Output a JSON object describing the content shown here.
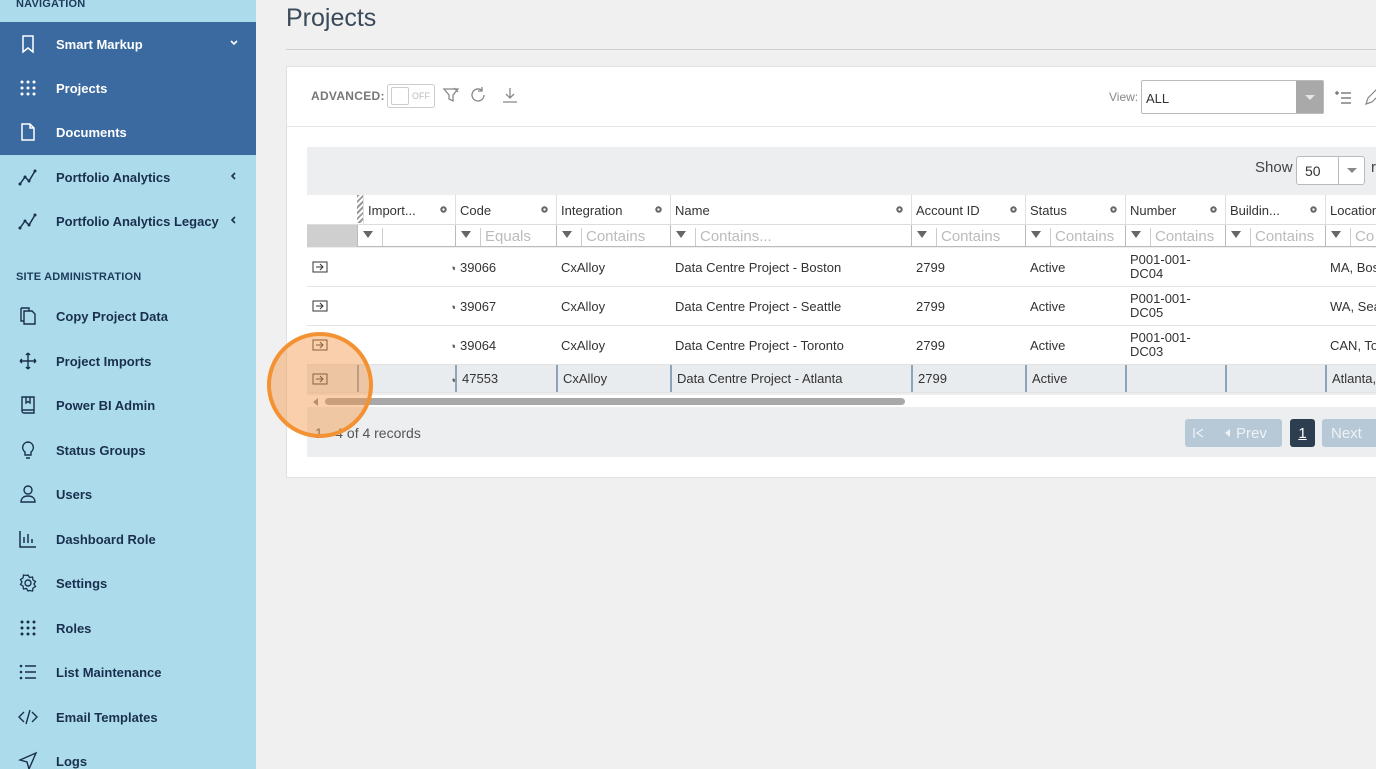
{
  "sidebar": {
    "nav_title": "NAVIGATION",
    "admin_title": "SITE ADMINISTRATION",
    "nav_items": [
      {
        "label": "Smart Markup",
        "icon": "bookmark-icon"
      },
      {
        "label": "Projects",
        "icon": "grid-dots-icon"
      },
      {
        "label": "Documents",
        "icon": "document-icon"
      },
      {
        "label": "Portfolio Analytics",
        "icon": "analytics-icon"
      },
      {
        "label": "Portfolio Analytics Legacy",
        "icon": "analytics-icon"
      }
    ],
    "admin_items": [
      {
        "label": "Copy Project Data",
        "icon": "copy-icon"
      },
      {
        "label": "Project Imports",
        "icon": "move-icon"
      },
      {
        "label": "Power BI Admin",
        "icon": "book-icon"
      },
      {
        "label": "Status Groups",
        "icon": "lightbulb-icon"
      },
      {
        "label": "Users",
        "icon": "user-icon"
      },
      {
        "label": "Dashboard Role",
        "icon": "bar-chart-icon"
      },
      {
        "label": "Settings",
        "icon": "gear-icon"
      },
      {
        "label": "Roles",
        "icon": "grid-dots-icon"
      },
      {
        "label": "List Maintenance",
        "icon": "list-icon"
      },
      {
        "label": "Email Templates",
        "icon": "code-icon"
      },
      {
        "label": "Logs",
        "icon": "send-icon"
      }
    ]
  },
  "page": {
    "title": "Projects"
  },
  "toolbar": {
    "advanced_label": "ADVANCED:",
    "toggle_state": "OFF",
    "view_label": "View:",
    "view_value": "ALL"
  },
  "grid": {
    "show_label": "Show",
    "show_value": "50",
    "show_suffix": "r",
    "columns": [
      {
        "label": "Import...",
        "filter": ""
      },
      {
        "label": "Code",
        "filter": "Equals"
      },
      {
        "label": "Integration",
        "filter": "Contains"
      },
      {
        "label": "Name",
        "filter": "Contains..."
      },
      {
        "label": "Account ID",
        "filter": "Contains"
      },
      {
        "label": "Status",
        "filter": "Contains"
      },
      {
        "label": "Number",
        "filter": "Contains"
      },
      {
        "label": "Buildin...",
        "filter": "Contains"
      },
      {
        "label": "Location",
        "filter": "Co"
      }
    ],
    "rows": [
      {
        "code": "39066",
        "integration": "CxAlloy",
        "name": "Data Centre Project - Boston",
        "account": "2799",
        "status": "Active",
        "number": "P001-001-DC04",
        "building": "",
        "location": "MA, Bos"
      },
      {
        "code": "39067",
        "integration": "CxAlloy",
        "name": "Data Centre Project - Seattle",
        "account": "2799",
        "status": "Active",
        "number": "P001-001-DC05",
        "building": "",
        "location": "WA, Sea"
      },
      {
        "code": "39064",
        "integration": "CxAlloy",
        "name": "Data Centre Project - Toronto",
        "account": "2799",
        "status": "Active",
        "number": "P001-001-DC03",
        "building": "",
        "location": "CAN, To"
      },
      {
        "code": "47553",
        "integration": "CxAlloy",
        "name": "Data Centre Project - Atlanta",
        "account": "2799",
        "status": "Active",
        "number": "",
        "building": "",
        "location": "Atlanta,"
      }
    ],
    "check_glyph": "✔",
    "records_text": "1 - 4 of 4 records",
    "pager": {
      "prev": "Prev",
      "page": "1",
      "next": "Next"
    }
  },
  "colors": {
    "sidebar_bg": "#acdcec",
    "sidebar_active": "#3b6aa0",
    "pager_active": "#2d3e50",
    "highlight": "#f39233"
  }
}
